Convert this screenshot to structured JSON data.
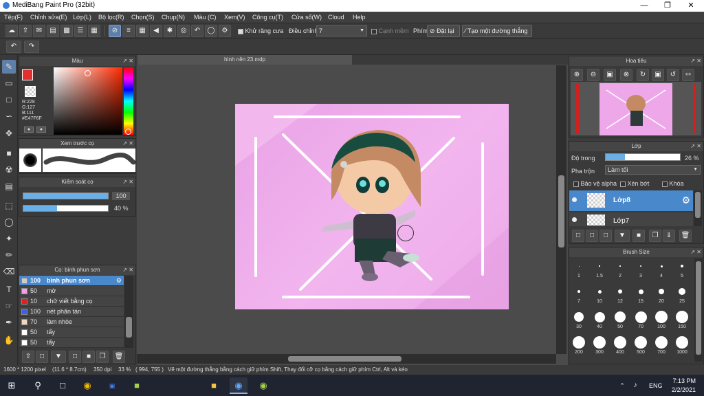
{
  "window": {
    "title": "MediBang Paint Pro (32bit)"
  },
  "menu": [
    "Tệp(F)",
    "Chỉnh sửa(E)",
    "Lớp(L)",
    "Bộ lọc(R)",
    "Chọn(S)",
    "Chụp(N)",
    "Màu (C)",
    "Xem(V)",
    "Công cụ(T)",
    "Cửa sổ(W)",
    "Cloud",
    "Help"
  ],
  "toolbar": {
    "antialias_label": "Khử răng cưa",
    "correction_label": "Điều chỉnh",
    "correction_value": "7",
    "edge_label": "Cạnh mềm",
    "key_label": "Phím",
    "reset_label": "Đặt lại",
    "line_label": "Tạo một đường thẳng"
  },
  "color_panel": {
    "title": "Màu",
    "r": "R:228",
    "g": "G:127",
    "b": "B:111",
    "hex": "#E47F6F",
    "primary": "#e03030",
    "hue_color": "#ff2a00"
  },
  "brush_preview": {
    "title": "Xem trước cọ"
  },
  "brush_control": {
    "title": "Kiểm soát cọ",
    "size": "100",
    "opacity": "40 %",
    "size_frac": 1.0,
    "opacity_frac": 0.4
  },
  "brush_list": {
    "title": "Cọ: bình phun sơn",
    "items": [
      {
        "size": "100",
        "label": "bình phun sơn",
        "color": "#cccccc"
      },
      {
        "size": "50",
        "label": "mờ",
        "color": "#f2a0ea"
      },
      {
        "size": "10",
        "label": "chữ viết bằng cọ",
        "color": "#e02020"
      },
      {
        "size": "100",
        "label": "nét phân tán",
        "color": "#4060e0"
      },
      {
        "size": "70",
        "label": "làm nhòe",
        "color": "#f3d6c0"
      },
      {
        "size": "50",
        "label": "tẩy",
        "color": "#ffffff"
      },
      {
        "size": "50",
        "label": "tẩy",
        "color": "#ffffff"
      }
    ]
  },
  "document": {
    "tab": "hình nền 23.mdp"
  },
  "navigator": {
    "title": "Hoa tiêu"
  },
  "layer_panel": {
    "title": "Lớp",
    "opacity_label": "Độ trong",
    "opacity": "26 %",
    "opacity_frac": 0.26,
    "blend_label": "Pha trộn",
    "blend_value": "Làm tối",
    "protect_alpha": "Bảo vệ alpha",
    "clipping": "Xén bớt",
    "lock": "Khóa",
    "layers": [
      {
        "name": "Lớp8"
      },
      {
        "name": "Lớp7"
      }
    ]
  },
  "brush_size": {
    "title": "Brush Size",
    "sizes": [
      "1",
      "1.5",
      "2",
      "3",
      "4",
      "5",
      "7",
      "10",
      "12",
      "15",
      "20",
      "25",
      "30",
      "40",
      "50",
      "70",
      "100",
      "150",
      "200",
      "300",
      "400",
      "500",
      "700",
      "1000"
    ]
  },
  "status": {
    "size": "1600 * 1200 pixel",
    "dims": "(11.6 * 8.7cm)",
    "dpi": "350 dpi",
    "zoom": "33 %",
    "coords": "( 994, 755 )",
    "hint": "Vẽ một đường thẳng bằng cách giữ phím Shift, Thay đổi cỡ cọ bằng cách giữ phím Ctrl, Alt và kéo"
  },
  "taskbar": {
    "lang": "ENG",
    "time": "7:13 PM",
    "date": "2/2/2021"
  }
}
